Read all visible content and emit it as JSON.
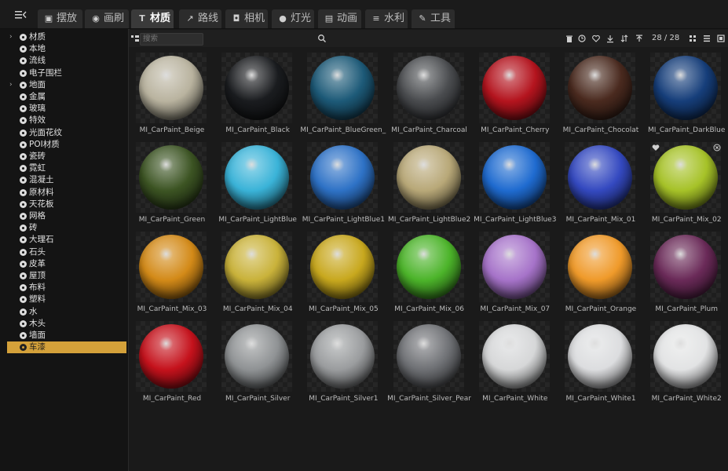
{
  "tabs": [
    {
      "label": "摆放",
      "icon": "box-icon",
      "active": false
    },
    {
      "label": "画刷",
      "icon": "brush-icon",
      "active": false
    },
    {
      "label": "材质",
      "icon": "material-icon",
      "active": true
    },
    {
      "label": "路线",
      "icon": "route-icon",
      "active": false
    },
    {
      "label": "相机",
      "icon": "camera-icon",
      "active": false
    },
    {
      "label": "灯光",
      "icon": "bulb-icon",
      "active": false
    },
    {
      "label": "动画",
      "icon": "film-icon",
      "active": false
    },
    {
      "label": "水利",
      "icon": "water-icon",
      "active": false
    },
    {
      "label": "工具",
      "icon": "wrench-icon",
      "active": false
    }
  ],
  "sidebar": {
    "items": [
      {
        "label": "材质",
        "arrow": true
      },
      {
        "label": "本地",
        "arrow": false
      },
      {
        "label": "流线",
        "arrow": false
      },
      {
        "label": "电子围栏",
        "arrow": false
      },
      {
        "label": "地面",
        "arrow": true
      },
      {
        "label": "金属",
        "arrow": false
      },
      {
        "label": "玻璃",
        "arrow": false
      },
      {
        "label": "特效",
        "arrow": false
      },
      {
        "label": "光面花纹",
        "arrow": false
      },
      {
        "label": "POI材质",
        "arrow": false
      },
      {
        "label": "瓷砖",
        "arrow": false
      },
      {
        "label": "霓虹",
        "arrow": false
      },
      {
        "label": "混凝土",
        "arrow": false
      },
      {
        "label": "原材料",
        "arrow": false
      },
      {
        "label": "天花板",
        "arrow": false
      },
      {
        "label": "网格",
        "arrow": false
      },
      {
        "label": "砖",
        "arrow": false
      },
      {
        "label": "大理石",
        "arrow": false
      },
      {
        "label": "石头",
        "arrow": false
      },
      {
        "label": "皮革",
        "arrow": false
      },
      {
        "label": "屋顶",
        "arrow": false
      },
      {
        "label": "布料",
        "arrow": false
      },
      {
        "label": "塑料",
        "arrow": false
      },
      {
        "label": "水",
        "arrow": false
      },
      {
        "label": "木头",
        "arrow": false
      },
      {
        "label": "墙面",
        "arrow": false
      },
      {
        "label": "车漆",
        "arrow": false,
        "selected": true
      }
    ]
  },
  "toolbar": {
    "search_placeholder": "搜索",
    "count": "28 / 28",
    "icons": [
      "trash-icon",
      "history-icon",
      "heart-icon",
      "import-icon",
      "sort-icon",
      "upload-icon",
      "grid-view-icon",
      "list-view-icon",
      "detail-view-icon"
    ]
  },
  "selected_color": "#d4a13a",
  "materials": [
    {
      "name": "MI_CarPaint_Beige",
      "color": "#b9b39f"
    },
    {
      "name": "MI_CarPaint_Black",
      "color": "#1a1c1f"
    },
    {
      "name": "MI_CarPaint_BlueGreen_Pe",
      "color": "#1d5a78"
    },
    {
      "name": "MI_CarPaint_Charcoal",
      "color": "#4a4c4f"
    },
    {
      "name": "MI_CarPaint_Cherry",
      "color": "#b4141e"
    },
    {
      "name": "MI_CarPaint_Chocolat",
      "color": "#4a2a1f"
    },
    {
      "name": "MI_CarPaint_DarkBlue",
      "color": "#163e7a"
    },
    {
      "name": "MI_CarPaint_Green",
      "color": "#3c5423"
    },
    {
      "name": "MI_CarPaint_LightBlue",
      "color": "#3ab3d8"
    },
    {
      "name": "MI_CarPaint_LightBlue1",
      "color": "#2e72c6"
    },
    {
      "name": "MI_CarPaint_LightBlue2",
      "color": "#b8a878"
    },
    {
      "name": "MI_CarPaint_LightBlue3",
      "color": "#1f6bd0"
    },
    {
      "name": "MI_CarPaint_Mix_01",
      "color": "#3449c0"
    },
    {
      "name": "MI_CarPaint_Mix_02",
      "color": "#a6c228"
    },
    {
      "name": "MI_CarPaint_Mix_03",
      "color": "#d38a18"
    },
    {
      "name": "MI_CarPaint_Mix_04",
      "color": "#c9b23a"
    },
    {
      "name": "MI_CarPaint_Mix_05",
      "color": "#c8a81e"
    },
    {
      "name": "MI_CarPaint_Mix_06",
      "color": "#4cb42a"
    },
    {
      "name": "MI_CarPaint_Mix_07",
      "color": "#a673c9"
    },
    {
      "name": "MI_CarPaint_Orange",
      "color": "#ef9a2a"
    },
    {
      "name": "MI_CarPaint_Plum",
      "color": "#6a2a58"
    },
    {
      "name": "MI_CarPaint_Red",
      "color": "#c5121c"
    },
    {
      "name": "MI_CarPaint_Silver",
      "color": "#8f9294"
    },
    {
      "name": "MI_CarPaint_Silver1",
      "color": "#9a9c9e"
    },
    {
      "name": "MI_CarPaint_Silver_Pear",
      "color": "#6e7074"
    },
    {
      "name": "MI_CarPaint_White",
      "color": "#d6d7d8"
    },
    {
      "name": "MI_CarPaint_White1",
      "color": "#dcdddf"
    },
    {
      "name": "MI_CarPaint_White2",
      "color": "#e2e3e4"
    }
  ]
}
